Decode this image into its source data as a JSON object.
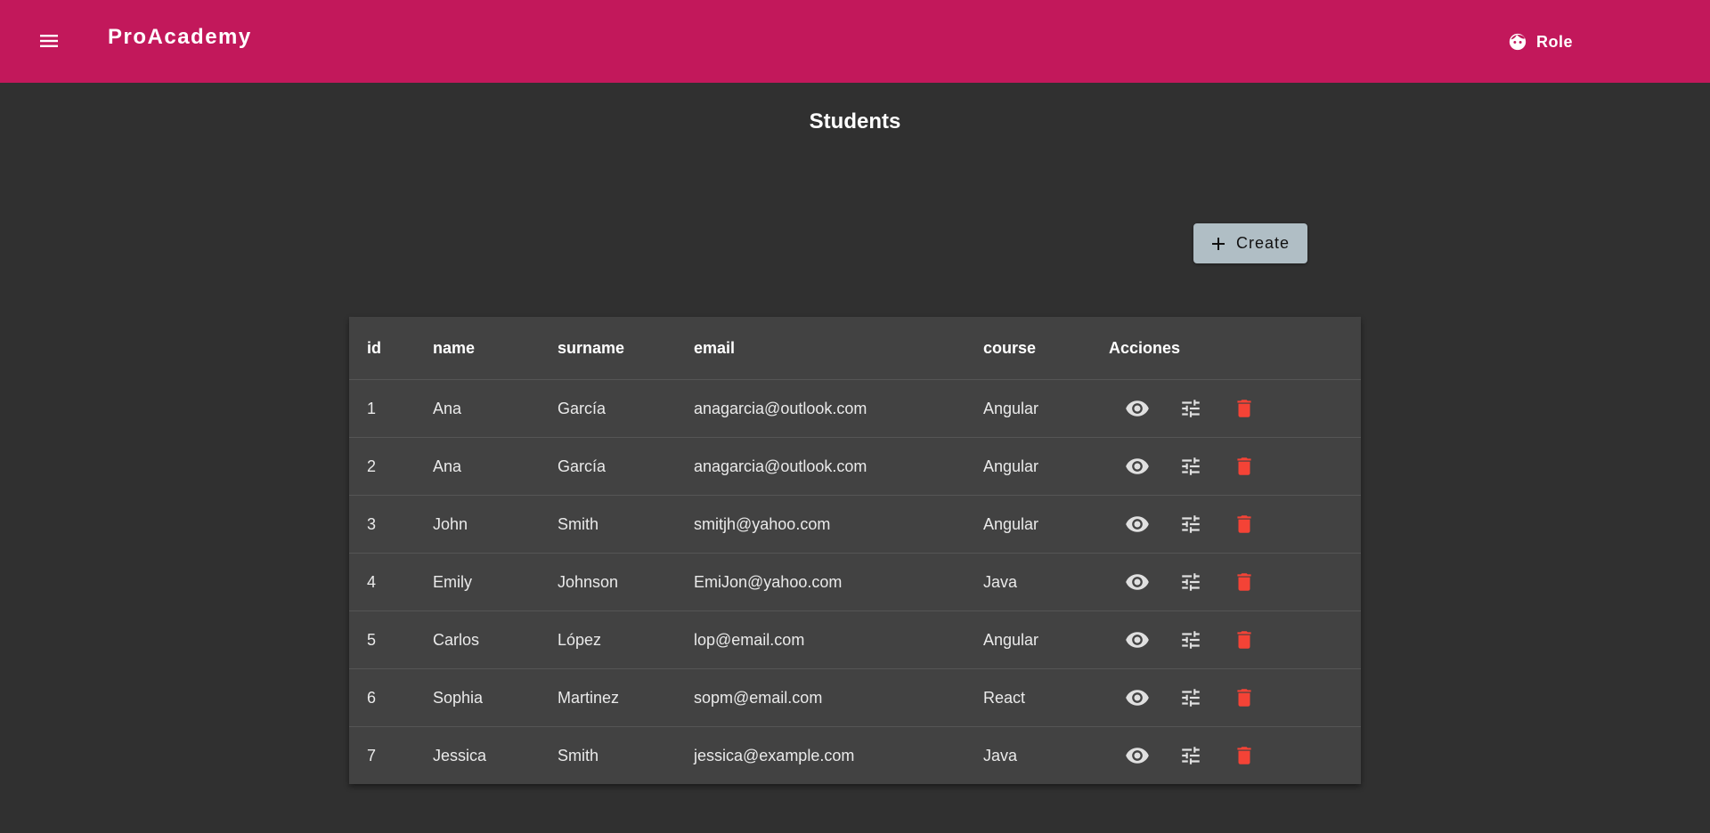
{
  "header": {
    "brand": "ProAcademy",
    "role_label": "Role"
  },
  "page": {
    "title": "Students",
    "create_label": "Create"
  },
  "table": {
    "columns": [
      "id",
      "name",
      "surname",
      "email",
      "course",
      "Acciones"
    ],
    "rows": [
      {
        "id": "1",
        "name": "Ana",
        "surname": "García",
        "email": "anagarcia@outlook.com",
        "course": "Angular"
      },
      {
        "id": "2",
        "name": "Ana",
        "surname": "García",
        "email": "anagarcia@outlook.com",
        "course": "Angular"
      },
      {
        "id": "3",
        "name": "John",
        "surname": "Smith",
        "email": "smitjh@yahoo.com",
        "course": "Angular"
      },
      {
        "id": "4",
        "name": "Emily",
        "surname": "Johnson",
        "email": "EmiJon@yahoo.com",
        "course": "Java"
      },
      {
        "id": "5",
        "name": "Carlos",
        "surname": "López",
        "email": "lop@email.com",
        "course": "Angular"
      },
      {
        "id": "6",
        "name": "Sophia",
        "surname": "Martinez",
        "email": "sopm@email.com",
        "course": "React"
      },
      {
        "id": "7",
        "name": "Jessica",
        "surname": "Smith",
        "email": "jessica@example.com",
        "course": "Java"
      }
    ]
  },
  "icons": {
    "menu": "menu-icon",
    "role": "face-icon",
    "create": "plus-icon",
    "view": "eye-icon",
    "edit": "tune-icon",
    "delete": "trash-icon"
  },
  "colors": {
    "toolbar": "#c2185b",
    "background": "#303030",
    "table": "#424242",
    "create_button": "#b0bec5",
    "delete": "#f44336"
  }
}
